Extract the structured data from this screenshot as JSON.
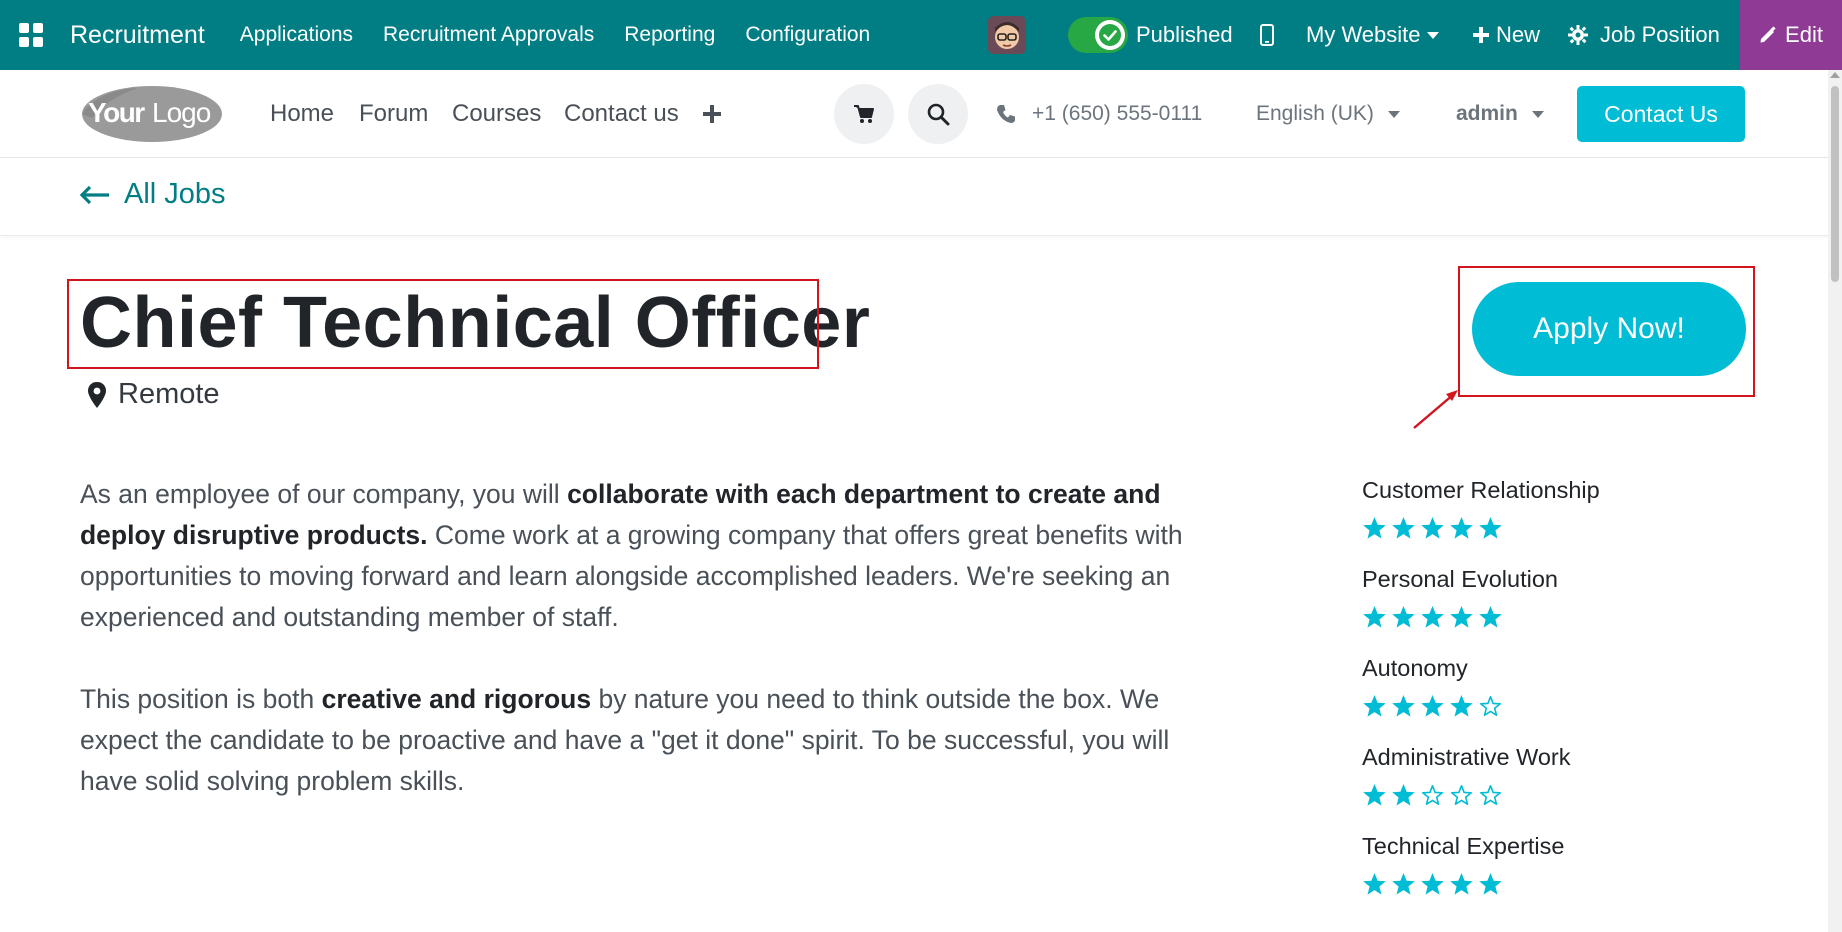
{
  "adminbar": {
    "app_name": "Recruitment",
    "menu": [
      "Applications",
      "Recruitment Approvals",
      "Reporting",
      "Configuration"
    ],
    "published_label": "Published",
    "website_label": "My Website",
    "new_label": "New",
    "job_position_label": "Job Position",
    "edit_label": "Edit"
  },
  "header": {
    "menu": [
      "Home",
      "Forum",
      "Courses",
      "Contact us"
    ],
    "phone": "+1 (650) 555-0111",
    "language": "English (UK)",
    "user": "admin",
    "contact_button": "Contact Us"
  },
  "back_link": "All Jobs",
  "job": {
    "title": "Chief Technical Officer",
    "location": "Remote",
    "apply_label": "Apply Now!",
    "paragraph1": {
      "part1": "As an employee of our company, you will ",
      "bold": "collaborate with each department to create and deploy disruptive products.",
      "part2": " Come work at a growing company that offers great benefits with opportunities to moving forward and learn alongside accomplished leaders. We're seeking an experienced and outstanding member of staff."
    },
    "paragraph2": {
      "part1": "This position is both ",
      "bold": "creative and rigorous",
      "part2": " by nature you need to think outside the box. We expect the candidate to be proactive and have a \"get it done\" spirit. To be successful, you will have solid solving problem skills."
    }
  },
  "ratings": [
    {
      "label": "Customer Relationship",
      "stars": 5
    },
    {
      "label": "Personal Evolution",
      "stars": 5
    },
    {
      "label": "Autonomy",
      "stars": 4
    },
    {
      "label": "Administrative Work",
      "stars": 2
    },
    {
      "label": "Technical Expertise",
      "stars": 5
    }
  ],
  "colors": {
    "admin_bar": "#017e84",
    "edit_bg": "#8f3a94",
    "accent": "#00bcd4",
    "highlight_box": "#d2151c"
  }
}
